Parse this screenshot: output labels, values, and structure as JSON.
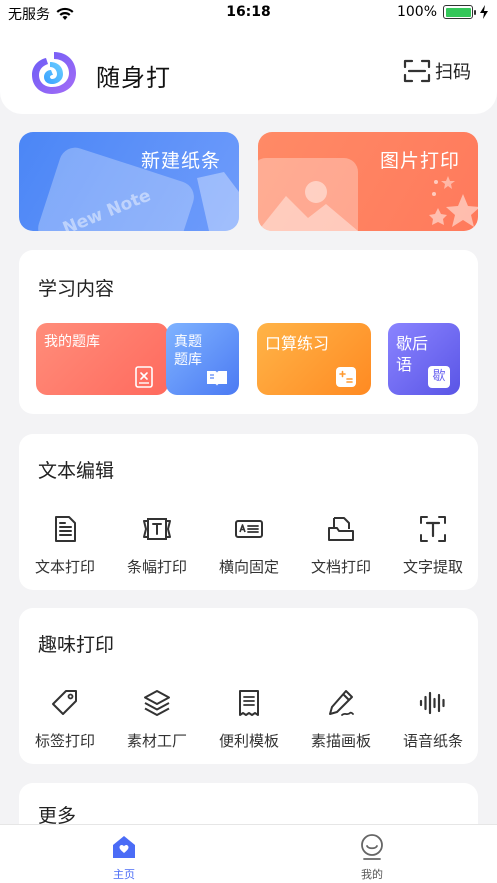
{
  "status_bar": {
    "carrier": "无服务",
    "time": "16:18",
    "battery_percent": "100%",
    "battery_level": 1.0
  },
  "header": {
    "app_name": "随身打",
    "scan_label": "扫码"
  },
  "banners": [
    {
      "label": "新建纸条",
      "deco_text": "New Note",
      "color": "#4b86f6"
    },
    {
      "label": "图片打印",
      "color": "#ff8a66"
    }
  ],
  "study": {
    "title": "学习内容",
    "tiles": [
      {
        "label": "我的题库",
        "icon": "book-x-icon"
      },
      {
        "label": "真题\n题库",
        "icon": "open-book-icon"
      },
      {
        "label": "口算练习",
        "icon": "calculator-icon"
      },
      {
        "label": "歇后\n语",
        "icon_char": "歇",
        "icon": "xie-char-icon"
      }
    ]
  },
  "text_edit": {
    "title": "文本编辑",
    "tools": [
      {
        "label": "文本打印",
        "icon": "document-icon"
      },
      {
        "label": "条幅打印",
        "icon": "banner-icon"
      },
      {
        "label": "横向固定",
        "icon": "landscape-card-icon"
      },
      {
        "label": "文档打印",
        "icon": "folder-doc-icon"
      },
      {
        "label": "文字提取",
        "icon": "text-extract-icon"
      }
    ]
  },
  "fun_print": {
    "title": "趣味打印",
    "tools": [
      {
        "label": "标签打印",
        "icon": "tag-icon"
      },
      {
        "label": "素材工厂",
        "icon": "layers-icon"
      },
      {
        "label": "便利模板",
        "icon": "receipt-icon"
      },
      {
        "label": "素描画板",
        "icon": "pencil-icon"
      },
      {
        "label": "语音纸条",
        "icon": "voice-wave-icon"
      }
    ]
  },
  "more": {
    "title": "更多"
  },
  "tabbar": {
    "home_label": "主页",
    "mine_label": "我的",
    "active_color": "#4b6cf6"
  }
}
